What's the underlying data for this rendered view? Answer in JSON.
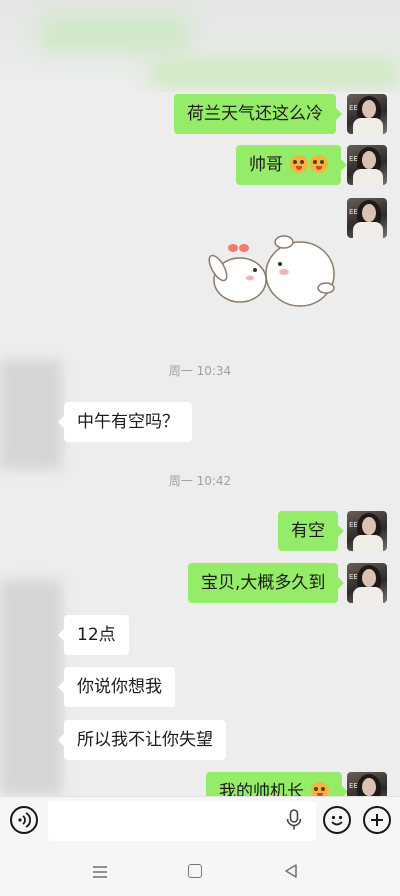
{
  "chat": {
    "messages": [
      {
        "text": "荷兰天气还这么冷"
      },
      {
        "text": "帅哥"
      },
      {
        "text": "中午有空吗？"
      },
      {
        "text": "有空"
      },
      {
        "text": "宝贝,大概多久到"
      },
      {
        "text": "12点"
      },
      {
        "text": "你说你想我"
      },
      {
        "text": "所以我不让你失望"
      },
      {
        "text": "我的帅机长"
      }
    ],
    "timestamps": [
      "周一 10:34",
      "周一 10:42"
    ]
  },
  "composer": {
    "value": "",
    "voice_icon": "voice-icon",
    "mic_icon": "mic-icon",
    "emoji_icon": "emoji-icon",
    "plus_icon": "plus-icon"
  },
  "nav": {
    "icons": [
      "menu-icon",
      "home-icon",
      "back-icon"
    ]
  },
  "colors": {
    "outgoing_bubble": "#95ec69",
    "incoming_bubble": "#ffffff",
    "background": "#ededed"
  }
}
